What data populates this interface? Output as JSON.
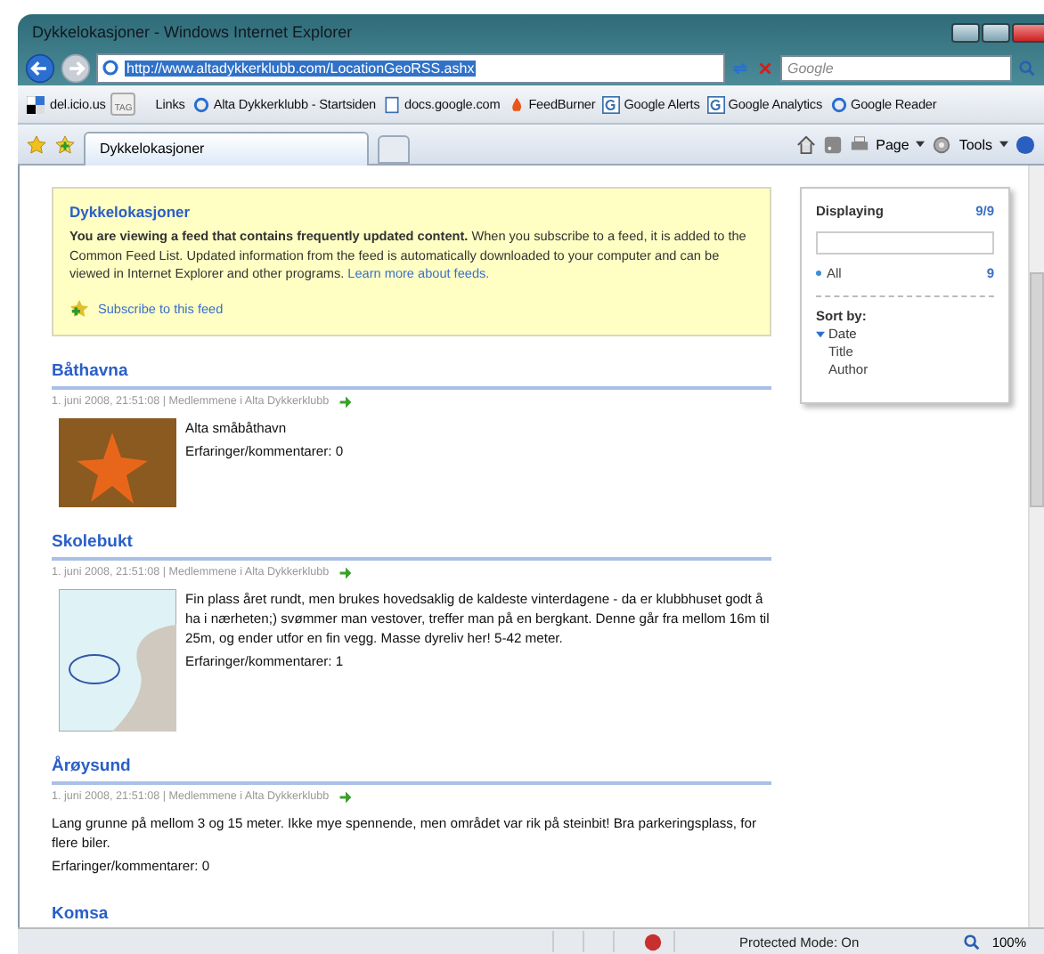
{
  "window": {
    "title": "Dykkelokasjoner - Windows Internet Explorer"
  },
  "address": {
    "url": "http://www.altadykkerklubb.com/LocationGeoRSS.ashx"
  },
  "search": {
    "placeholder": "Google"
  },
  "links_bar": {
    "delicious": "del.icio.us",
    "tag": "TAG",
    "links_label": "Links",
    "links": [
      {
        "label": "Alta Dykkerklubb - Startsiden",
        "kind": "ie"
      },
      {
        "label": "docs.google.com",
        "kind": "doc"
      },
      {
        "label": "FeedBurner",
        "kind": "flame"
      },
      {
        "label": "Google Alerts",
        "kind": "g"
      },
      {
        "label": "Google Analytics",
        "kind": "g"
      },
      {
        "label": "Google Reader",
        "kind": "ie"
      }
    ]
  },
  "tabs": [
    {
      "title": "Dykkelokasjoner",
      "selected": true
    }
  ],
  "command_bar": {
    "page": "Page",
    "tools": "Tools"
  },
  "feed_box": {
    "title": "Dykkelokasjoner",
    "text": "**You are viewing a feed that contains frequently updated content.** When you subscribe to a feed, it is added to the Common Feed List. Updated information from the feed is automatically downloaded to your computer and can be viewed in Internet Explorer and other programs.",
    "learn_link": "Learn more about feeds.",
    "subscribe": "Subscribe to this feed"
  },
  "sidebar": {
    "displaying": "Displaying",
    "count": "9/9",
    "filter": "All",
    "filter_count": "9",
    "sort_label": "Sort by:",
    "sort_options": [
      {
        "label": "Date",
        "selected": true
      },
      {
        "label": "Title",
        "selected": false
      },
      {
        "label": "Author",
        "selected": false
      }
    ]
  },
  "items": [
    {
      "title": "Båthavna",
      "meta": "1. juni 2008, 21:51:08 | Medlemmene i Alta Dykkerklubb",
      "kind": "photo",
      "lines": [
        "Alta småbåthavn",
        "Erfaringer/kommentarer: 0"
      ]
    },
    {
      "title": "Skolebukt",
      "meta": "1. juni 2008, 21:51:08 | Medlemmene i Alta Dykkerklubb",
      "kind": "map",
      "lines": [
        "Fin plass året rundt, men brukes hovedsaklig de kaldeste vinterdagene - da er klubbhuset godt å ha i nærheten;) svømmer man vestover, treffer man på en bergkant. Denne går fra mellom 16m til 25m, og ender utfor en fin vegg. Masse dyreliv her! 5-42 meter.",
        "Erfaringer/kommentarer: 1"
      ]
    },
    {
      "title": "Årøysund",
      "meta": "1. juni 2008, 21:51:08 | Medlemmene i Alta Dykkerklubb",
      "lines": [
        "Lang grunne på mellom 3 og 15 meter. Ikke mye spennende, men området var rik på steinbit! Bra parkeringsplass, for flere biler.",
        "Erfaringer/kommentarer: 0"
      ]
    },
    {
      "title": "Komsa"
    }
  ],
  "status_bar": {
    "mode": "Protected Mode: On",
    "zoom": "100%"
  }
}
